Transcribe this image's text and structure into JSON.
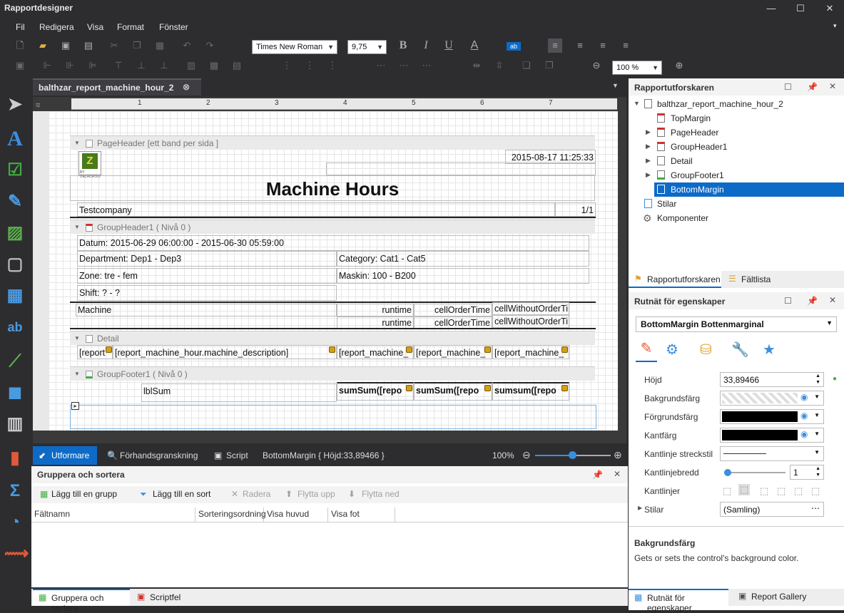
{
  "window": {
    "title": "Rapportdesigner",
    "min": "—",
    "max": "☐",
    "close": "✕"
  },
  "menu": [
    "Fil",
    "Redigera",
    "Visa",
    "Format",
    "Fönster"
  ],
  "toolbar": {
    "font": "Times New Roman",
    "size": "9,75",
    "zoom": "100 %",
    "bold": "B",
    "italic": "I",
    "underline": "U",
    "fontcolor": "A"
  },
  "doc_tab": "balthzar_report_machine_hour_2",
  "ruler": [
    "1",
    "2",
    "3",
    "4",
    "5",
    "6",
    "7"
  ],
  "report": {
    "pageheader_band": "PageHeader [ett band per sida ]",
    "logo_text": "BY DELACROIX",
    "datetime": "2015-08-17 11:25:33",
    "title": "Machine Hours",
    "company": "Testcompany",
    "pages": "1/1",
    "groupheader_band": "GroupHeader1 ( Nivå 0 )",
    "datum": "Datum: 2015-06-29 06:00:00 - 2015-06-30 05:59:00",
    "department": "Department: Dep1 - Dep3",
    "category": "Category: Cat1 - Cat5",
    "zone": "Zone: tre - fem",
    "maskin": "Maskin: 100 - B200",
    "shift": "Shift: ? - ?",
    "col_machine": "Machine",
    "col_runtime": "runtime",
    "col_order": "cellOrderTime",
    "col_without": "cellWithoutOrderTi",
    "col_runtime2": "runtime",
    "col_order2": "cellOrderTime",
    "col_without2": "cellWithoutOrderTi",
    "detail_band": "Detail",
    "d1": "[report",
    "d2": "[report_machine_hour.machine_description]",
    "d3": "[report_machine_",
    "d4": "[report_machine_",
    "d5": "[report_machine_",
    "groupfooter_band": "GroupFooter1 ( Nivå 0 )",
    "lblsum": "lblSum",
    "s1": "sumSum([repo",
    "s2": "sumSum([repo",
    "s3": "sumsum([repo"
  },
  "status": {
    "designer": "Utformare",
    "preview": "Förhandsgranskning",
    "script": "Script",
    "selection": "BottomMargin { Höjd:33,89466 }",
    "zoom": "100%"
  },
  "groupsort": {
    "title": "Gruppera och sortera",
    "add_group": "Lägg till en grupp",
    "add_sort": "Lägg till en sort",
    "delete": "Radera",
    "move_up": "Flytta upp",
    "move_down": "Flytta ned",
    "columns": [
      "Fältnamn",
      "Sorteringsordning",
      "Visa huvud",
      "Visa fot"
    ]
  },
  "bottom_tabs": {
    "groupsort": "Gruppera och sortera",
    "scripterr": "Scriptfel"
  },
  "explorer": {
    "title": "Rapportutforskaren",
    "root": "balthzar_report_machine_hour_2",
    "items": [
      "TopMargin",
      "PageHeader",
      "GroupHeader1",
      "Detail",
      "GroupFooter1",
      "BottomMargin"
    ],
    "styles": "Stilar",
    "components": "Komponenter",
    "tab1": "Rapportutforskaren",
    "tab2": "Fältlista"
  },
  "props": {
    "title": "Rutnät för egenskaper",
    "selector": "BottomMargin   Bottenmarginal",
    "rows": [
      {
        "label": "Höjd",
        "value": "33,89466"
      },
      {
        "label": "Bakgrundsfärg",
        "value": ""
      },
      {
        "label": "Förgrundsfärg",
        "value": ""
      },
      {
        "label": "Kantfärg",
        "value": ""
      },
      {
        "label": "Kantlinje streckstil",
        "value": ""
      },
      {
        "label": "Kantlinjebredd",
        "value": "1"
      },
      {
        "label": "Kantlinjer",
        "value": ""
      },
      {
        "label": "Stilar",
        "value": "(Samling)"
      }
    ],
    "desc_title": "Bakgrundsfärg",
    "desc_text": "Gets or sets the control's background color.",
    "tab1": "Rutnät för egenskaper",
    "tab2": "Report Gallery"
  },
  "colors": {
    "accent": "#0e6ac7",
    "dark": "#2d2d30"
  }
}
